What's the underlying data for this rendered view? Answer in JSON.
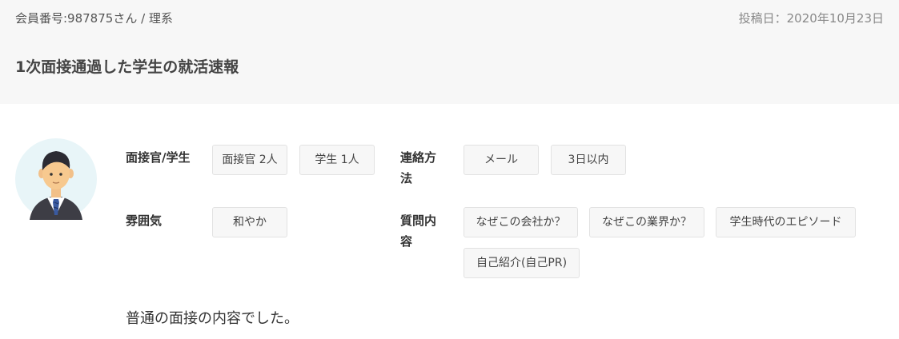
{
  "post": {
    "member_line": "会員番号:987875さん / 理系",
    "posted_date": "投稿日：2020年10月23日",
    "title": "1次面接通過した学生の就活速報"
  },
  "avatar": {
    "icon": "businessman-avatar-icon",
    "bg_color": "#e8f5f8"
  },
  "details": {
    "interviewer_label": "面接官/学生",
    "interviewer_tags": [
      "面接官 2人",
      "学生 1人"
    ],
    "contact_label_line1": "連絡方",
    "contact_label_line2": "法",
    "contact_tags": [
      "メール",
      "3日以内"
    ],
    "atmosphere_label": "雰囲気",
    "atmosphere_tags": [
      "和やか"
    ],
    "questions_label_line1": "質問内",
    "questions_label_line2": "容",
    "question_tags": [
      "なぜこの会社か？",
      "なぜこの業界か？",
      "学生時代のエピソード",
      "自己紹介(自己PR)"
    ]
  },
  "comment": "普通の面接の内容でした。",
  "colors": {
    "header_bg": "#f7f7f7",
    "tag_bg": "#f7f7f7",
    "tag_border": "#e2e2e2",
    "text": "#333333"
  }
}
